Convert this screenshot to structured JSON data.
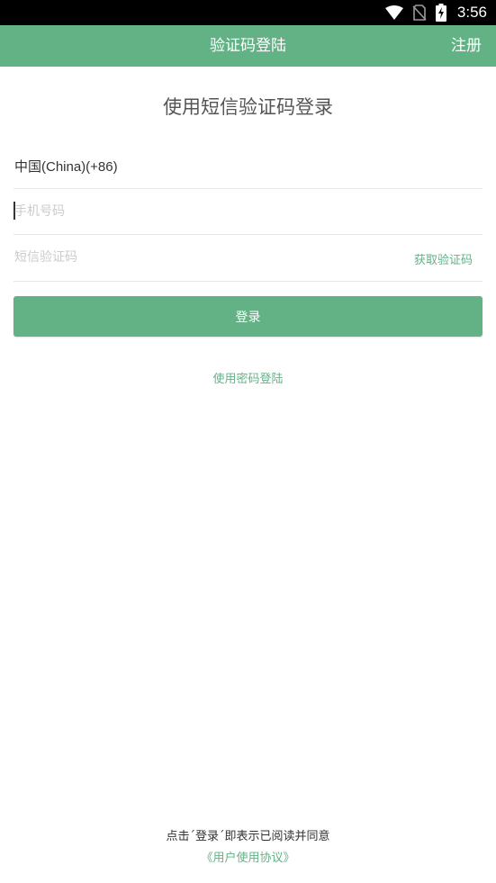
{
  "status_bar": {
    "time": "3:56",
    "icons": [
      "wifi-icon",
      "no-sim-icon",
      "battery-charging-icon"
    ]
  },
  "app_bar": {
    "title": "验证码登陆",
    "register_label": "注册"
  },
  "heading": "使用短信验证码登录",
  "form": {
    "country": "中国(China)(+86)",
    "phone_placeholder": "手机号码",
    "code_placeholder": "短信验证码",
    "get_code_label": "获取验证码",
    "login_label": "登录"
  },
  "password_login_label": "使用密码登陆",
  "footer": {
    "note": "点击´登录´即表示已阅读并同意",
    "agreement_link": "《用户使用协议》"
  },
  "colors": {
    "accent": "#63b285",
    "status_bar": "#000000",
    "divider": "#e6e6e6",
    "placeholder": "#cccccc"
  }
}
